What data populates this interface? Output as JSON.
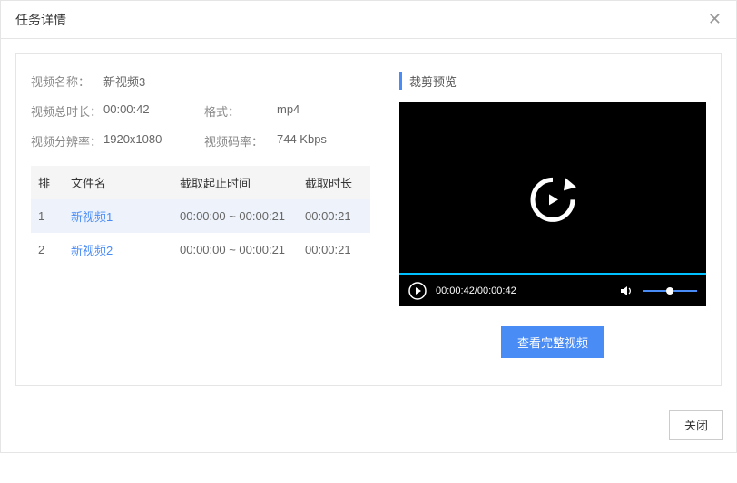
{
  "header": {
    "title": "任务详情"
  },
  "info": {
    "name_label": "视频名称：",
    "name_value": "新视频3",
    "duration_label": "视频总时长：",
    "duration_value": "00:00:42",
    "format_label": "格式：",
    "format_value": "mp4",
    "resolution_label": "视频分辨率：",
    "resolution_value": "1920x1080",
    "bitrate_label": "视频码率：",
    "bitrate_value": "744 Kbps"
  },
  "table": {
    "headers": {
      "index": "排",
      "filename": "文件名",
      "timerange": "截取起止时间",
      "length": "截取时长"
    },
    "rows": [
      {
        "index": "1",
        "filename": "新视频1",
        "timerange": "00:00:00 ~ 00:00:21",
        "length": "00:00:21",
        "selected": true
      },
      {
        "index": "2",
        "filename": "新视频2",
        "timerange": "00:00:00 ~ 00:00:21",
        "length": "00:00:21",
        "selected": false
      }
    ]
  },
  "preview": {
    "title": "裁剪预览",
    "current_time": "00:00:42",
    "total_time": "00:00:42",
    "view_full_btn": "查看完整视频"
  },
  "footer": {
    "close": "关闭"
  }
}
